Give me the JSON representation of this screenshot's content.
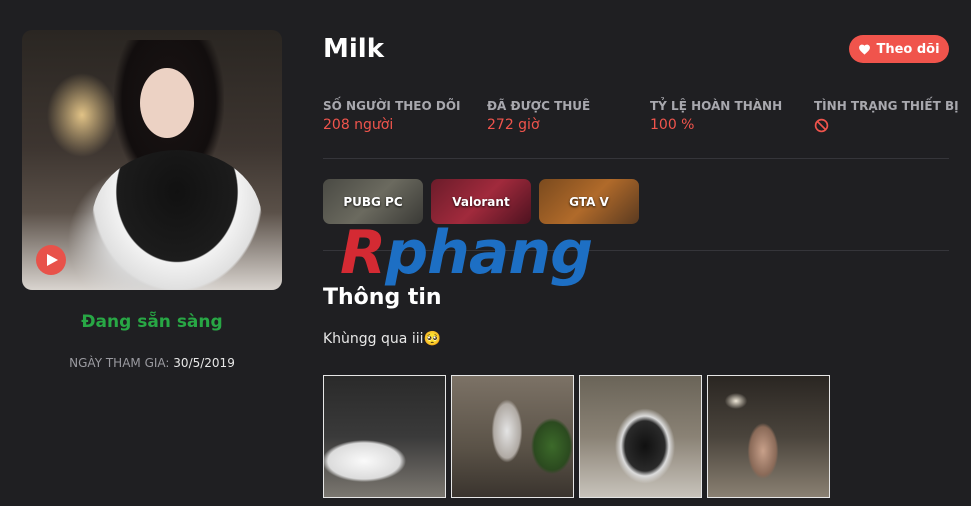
{
  "profile": {
    "status": "Đang sẵn sàng",
    "join_label": "NGÀY THAM GIA:",
    "join_date": "30/5/2019"
  },
  "header": {
    "name": "Milk",
    "follow_label": "Theo dõi"
  },
  "stats": [
    {
      "label": "SỐ NGƯỜI THEO DÕI",
      "value": "208 người"
    },
    {
      "label": "ĐÃ ĐƯỢC THUÊ",
      "value": "272 giờ"
    },
    {
      "label": "TỶ LỆ HOÀN THÀNH",
      "value": "100 %"
    },
    {
      "label": "TÌNH TRẠNG THIẾT BỊ",
      "icon": "ban-icon"
    }
  ],
  "games": [
    "PUBG PC",
    "Valorant",
    "GTA V"
  ],
  "watermark": {
    "first": "R",
    "rest": "phang"
  },
  "info": {
    "title": "Thông tin",
    "bio": "Khùngg qua iii🥺"
  },
  "colors": {
    "accent": "#f0544c",
    "ready": "#28a745",
    "background": "#1f1f22"
  }
}
